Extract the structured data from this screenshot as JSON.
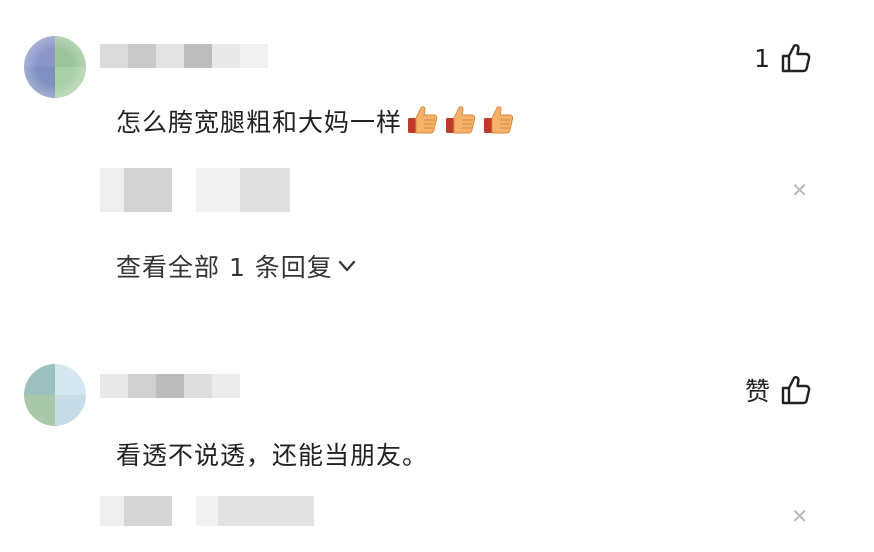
{
  "comments": [
    {
      "like_count": "1",
      "text": "怎么胯宽腿粗和大妈一样",
      "emoji_icon": "thumbs-up-emoji",
      "emoji_count": 3,
      "replies_label": "查看全部 1 条回复",
      "username_blurred": true
    },
    {
      "like_label": "赞",
      "text": "看透不说透，还能当朋友。",
      "username_blurred": true
    }
  ],
  "icons": {
    "like": "thumb-up-outline-icon",
    "close": "close-icon",
    "expand": "chevron-down-icon"
  },
  "colors": {
    "text": "#222222",
    "close_icon": "#b8b8b8"
  }
}
